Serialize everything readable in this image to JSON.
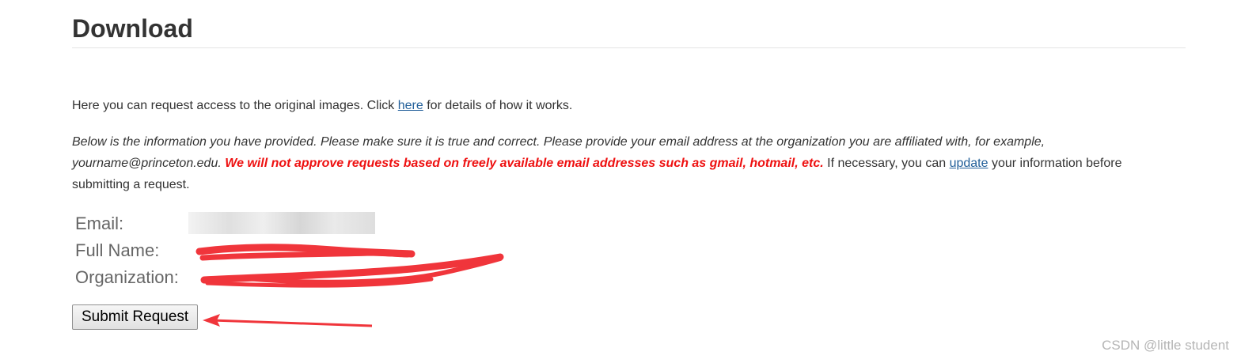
{
  "header": {
    "title": "Download"
  },
  "intro": {
    "text_before": "Here you can request access to the original images. Click ",
    "link": "here",
    "text_after": " for details of how it works."
  },
  "notice": {
    "italic_text": "Below is the information you have provided. Please make sure it is true and correct. Please provide your email address at the organization you are affiliated with, for example, yourname@princeton.edu.",
    "warning": "We will not approve requests based on freely available email addresses such as gmail, hotmail, etc.",
    "text_before_link": " If necessary, you can ",
    "link": "update",
    "text_after_link": " your information before submitting a request."
  },
  "info": {
    "email_label": "Email:",
    "full_name_label": "Full Name:",
    "organization_label": "Organization:"
  },
  "actions": {
    "submit_label": "Submit Request"
  },
  "watermark": "CSDN @little student",
  "colors": {
    "link": "#23609a",
    "warning": "#ee1111",
    "annotation": "#f0353b"
  }
}
